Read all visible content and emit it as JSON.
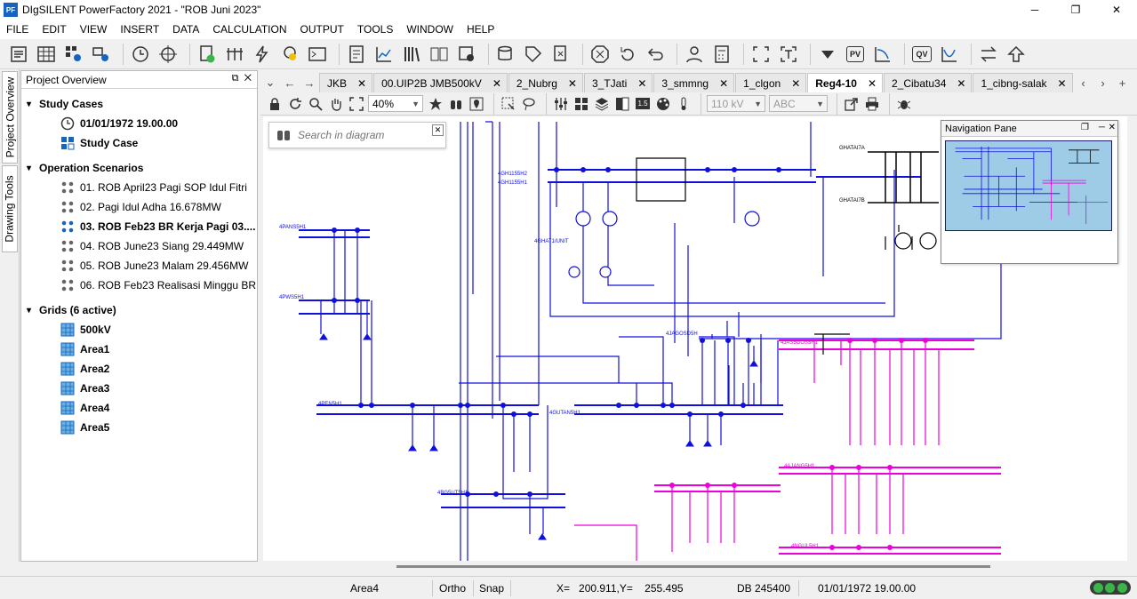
{
  "window": {
    "title": "DIgSILENT PowerFactory 2021  -  \"ROB Juni 2023\"",
    "app_icon": "PF",
    "min": "─",
    "max": "❐",
    "close": "✕"
  },
  "menu": [
    "FILE",
    "EDIT",
    "VIEW",
    "INSERT",
    "DATA",
    "CALCULATION",
    "OUTPUT",
    "TOOLS",
    "WINDOW",
    "HELP"
  ],
  "toolbar": {
    "text_buttons": [
      "PV",
      "QV"
    ]
  },
  "side_tabs": [
    "Project Overview",
    "Drawing Tools"
  ],
  "project_overview": {
    "title": "Project Overview",
    "study_cases": {
      "label": "Study Cases",
      "items": [
        {
          "label": "01/01/1972 19.00.00",
          "icon": "clock-icon"
        },
        {
          "label": "Study Case",
          "icon": "study-case-icon"
        }
      ]
    },
    "scenarios": {
      "label": "Operation Scenarios",
      "items": [
        "01. ROB April23 Pagi SOP Idul Fitri",
        "02. Pagi Idul Adha 16.678MW",
        "03. ROB Feb23 BR Kerja Pagi 03....",
        "04. ROB June23 Siang 29.449MW",
        "05. ROB June23 Malam 29.456MW",
        "06. ROB Feb23 Realisasi Minggu BR ..."
      ],
      "active_index": 2
    },
    "grids": {
      "label": "Grids (6 active)",
      "items": [
        "500kV",
        "Area1",
        "Area2",
        "Area3",
        "Area4",
        "Area5"
      ]
    }
  },
  "tabs": [
    {
      "label": "JKB",
      "active": false
    },
    {
      "label": "00.UIP2B JMB500kV",
      "active": false
    },
    {
      "label": "2_Nubrg",
      "active": false
    },
    {
      "label": "3_TJati",
      "active": false
    },
    {
      "label": "3_smmng",
      "active": false
    },
    {
      "label": "1_clgon",
      "active": false
    },
    {
      "label": "Reg4-10",
      "active": true
    },
    {
      "label": "2_Cibatu34",
      "active": false
    },
    {
      "label": "1_cibng-salak",
      "active": false
    }
  ],
  "diagram_toolbar": {
    "zoom": "40%",
    "voltage": "110 kV",
    "text_style": "ABC",
    "level_badge": "1.5"
  },
  "search": {
    "placeholder": "Search in diagram"
  },
  "nav_pane": {
    "title": "Navigation Pane"
  },
  "diagram_labels": {
    "b1": "4GH1155H2",
    "b2": "4GH1155H1",
    "b3": "4PANS5H1",
    "b4": "4PWS5H1",
    "b5": "4PEN5H1",
    "b6": "4GUTAN5H1",
    "b7": "4BG5UT5H1",
    "b8": "4AJANG5H1",
    "b9": "4JAS5GOS5H1",
    "b10": "4NGUL5H1",
    "b11": "GHATAI7A",
    "b12": "GHATAI7B",
    "b13": "4GHAT1/UNIT",
    "b14": "4JAGOSD5H"
  },
  "status": {
    "area": "Area4",
    "ortho": "Ortho",
    "snap": "Snap",
    "coords": "X=   200.911,Y=    255.495",
    "db": "DB 245400",
    "datetime": "01/01/1972 19.00.00"
  },
  "colors": {
    "diagram_blue": "#1010dd",
    "diagram_magenta": "#ee00dd",
    "accent": "#1565c0"
  }
}
